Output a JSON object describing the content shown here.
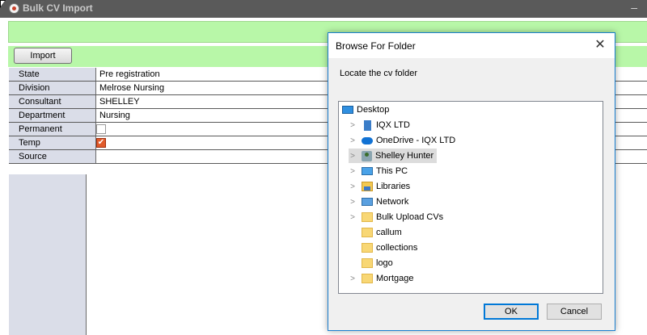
{
  "window": {
    "title": "Bulk CV Import",
    "minimize": "–"
  },
  "toolbar": {
    "import_label": "Import"
  },
  "fields": [
    {
      "label": "State",
      "value": "Pre registration"
    },
    {
      "label": "Division",
      "value": "Melrose Nursing"
    },
    {
      "label": "Consultant",
      "value": "SHELLEY"
    },
    {
      "label": "Department",
      "value": "Nursing"
    },
    {
      "label": "Permanent",
      "checked": false
    },
    {
      "label": "Temp",
      "checked": true
    },
    {
      "label": "Source",
      "value": ""
    }
  ],
  "dialog": {
    "title": "Browse For Folder",
    "close": "✕",
    "message": "Locate the cv folder",
    "ok_label": "OK",
    "cancel_label": "Cancel",
    "tree": [
      {
        "label": "Desktop",
        "icon": "desktop-icon"
      },
      {
        "label": "IQX LTD",
        "icon": "building-icon"
      },
      {
        "label": "OneDrive - IQX LTD",
        "icon": "cloud-icon"
      },
      {
        "label": "Shelley Hunter",
        "icon": "user-icon",
        "selected": true
      },
      {
        "label": "This PC",
        "icon": "pc-icon"
      },
      {
        "label": "Libraries",
        "icon": "library-icon"
      },
      {
        "label": "Network",
        "icon": "network-icon"
      },
      {
        "label": "Bulk Upload CVs",
        "icon": "folder-icon"
      },
      {
        "label": "callum",
        "icon": "folder-icon"
      },
      {
        "label": "collections",
        "icon": "folder-icon"
      },
      {
        "label": "logo",
        "icon": "folder-icon"
      },
      {
        "label": "Mortgage",
        "icon": "folder-icon"
      }
    ]
  }
}
